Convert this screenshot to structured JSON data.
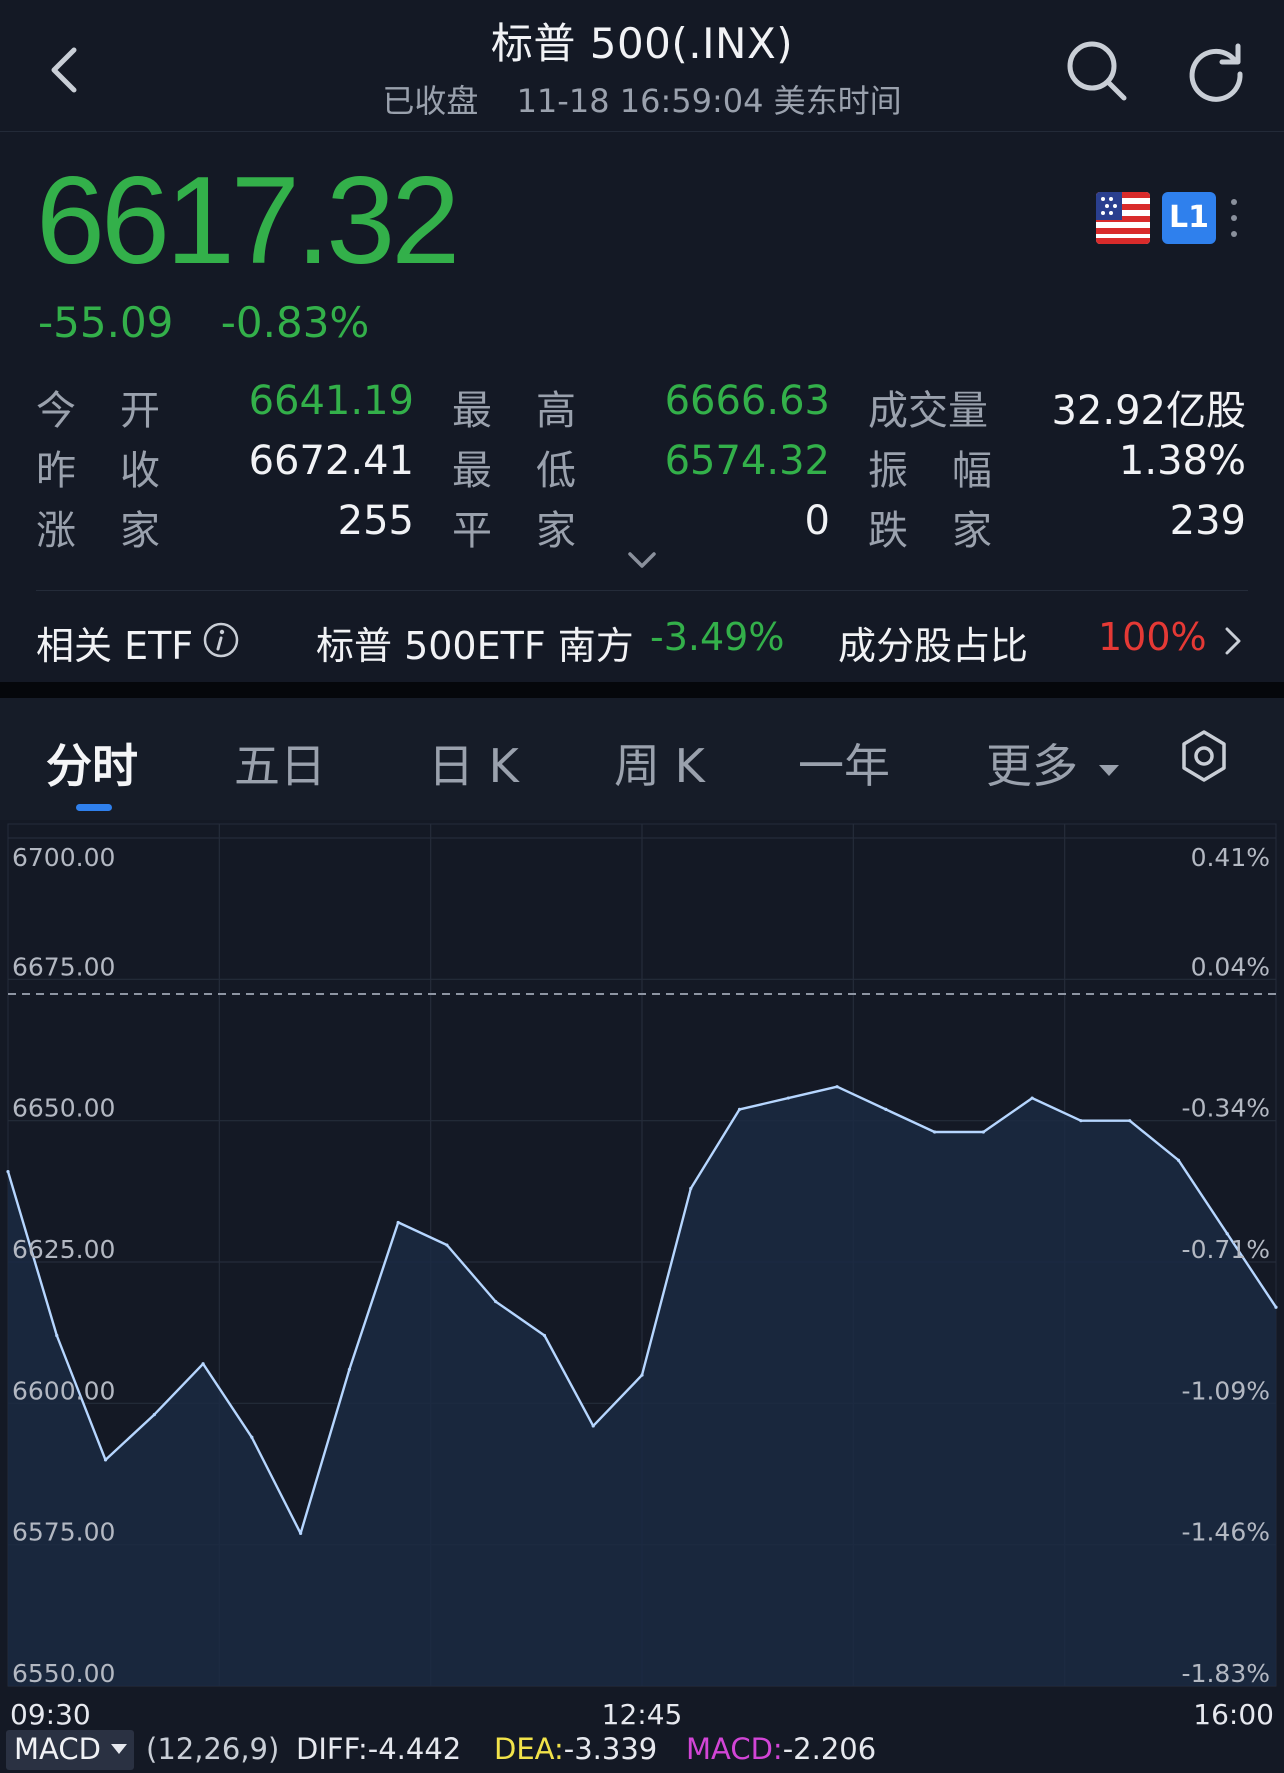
{
  "header": {
    "title": "标普 500(.INX)",
    "status": "已收盘",
    "datetime": "11-18 16:59:04 美东时间",
    "back_icon": "chevron-left-icon",
    "search_icon": "search-icon",
    "refresh_icon": "refresh-icon"
  },
  "quote": {
    "price": "6617.32",
    "change": "-55.09",
    "change_pct": "-0.83%",
    "market_badge": "L1",
    "flag_icon": "us-flag-icon",
    "stats": [
      {
        "label_a": "今",
        "label_b": "开",
        "value": "6641.19",
        "color": "green"
      },
      {
        "label_a": "最",
        "label_b": "高",
        "value": "6666.63",
        "color": "green"
      },
      {
        "label_a": "成交量",
        "label_b": "",
        "value": "32.92亿股",
        "color": "white"
      },
      {
        "label_a": "昨",
        "label_b": "收",
        "value": "6672.41",
        "color": "white"
      },
      {
        "label_a": "最",
        "label_b": "低",
        "value": "6574.32",
        "color": "green"
      },
      {
        "label_a": "振",
        "label_b": "幅",
        "value": "1.38%",
        "color": "white"
      },
      {
        "label_a": "涨",
        "label_b": "家",
        "value": "255",
        "color": "white"
      },
      {
        "label_a": "平",
        "label_b": "家",
        "value": "0",
        "color": "white"
      },
      {
        "label_a": "跌",
        "label_b": "家",
        "value": "239",
        "color": "white"
      }
    ]
  },
  "etf": {
    "label": "相关 ETF",
    "info_icon": "info-icon",
    "name": "标普 500ETF 南方",
    "pct": "-3.49%",
    "ratio_label": "成分股占比",
    "ratio_value": "100%"
  },
  "tabs": [
    "分时",
    "五日",
    "日 K",
    "周 K",
    "一年",
    "更多"
  ],
  "settings_icon": "gear-icon",
  "colors": {
    "up": "#e53935",
    "down": "#33b04a",
    "accent": "#2f80ed",
    "line": "#b6d6ff"
  },
  "chart_data": {
    "type": "line",
    "y_labels_left": [
      "6700.00",
      "6675.00",
      "6650.00",
      "6625.00",
      "6600.00",
      "6575.00",
      "6550.00"
    ],
    "y_labels_right": [
      "0.41%",
      "0.04%",
      "-0.34%",
      "-0.71%",
      "-1.09%",
      "-1.46%",
      "-1.83%"
    ],
    "x_labels": [
      "09:30",
      "12:45",
      "16:00"
    ],
    "ylim": [
      6550,
      6700
    ],
    "prev_close": 6672.41,
    "x": [
      "09:30",
      "09:45",
      "10:00",
      "10:15",
      "10:30",
      "10:45",
      "11:00",
      "11:15",
      "11:30",
      "11:45",
      "12:00",
      "12:15",
      "12:30",
      "12:45",
      "13:00",
      "13:15",
      "13:30",
      "13:45",
      "14:00",
      "14:15",
      "14:30",
      "14:45",
      "15:00",
      "15:15",
      "15:30",
      "15:45",
      "16:00"
    ],
    "values": [
      6641,
      6612,
      6590,
      6598,
      6607,
      6594,
      6577,
      6606,
      6632,
      6628,
      6618,
      6612,
      6596,
      6605,
      6638,
      6652,
      6654,
      6656,
      6652,
      6648,
      6648,
      6654,
      6650,
      6650,
      6643,
      6630,
      6617
    ]
  },
  "macd": {
    "label": "MACD",
    "params": "(12,26,9)",
    "diff_label": "DIFF:",
    "diff": "-4.442",
    "dea_label": "DEA:",
    "dea": "-3.339",
    "macd_label": "MACD:",
    "macd": "-2.206"
  }
}
